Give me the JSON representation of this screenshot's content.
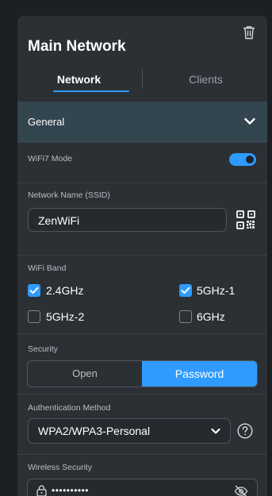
{
  "header": {
    "title": "Main Network",
    "tabs": [
      {
        "label": "Network",
        "active": true
      },
      {
        "label": "Clients",
        "active": false
      }
    ]
  },
  "section": {
    "label": "General",
    "expanded": true
  },
  "wifi7": {
    "label": "WiFi7 Mode",
    "enabled": true
  },
  "ssid": {
    "label": "Network Name (SSID)",
    "value": "ZenWiFi"
  },
  "wifi_band": {
    "label": "WiFi Band",
    "options": [
      {
        "label": "2.4GHz",
        "checked": true
      },
      {
        "label": "5GHz-1",
        "checked": true
      },
      {
        "label": "5GHz-2",
        "checked": false
      },
      {
        "label": "6GHz",
        "checked": false
      }
    ]
  },
  "security": {
    "label": "Security",
    "options": [
      "Open",
      "Password"
    ],
    "selected": "Password"
  },
  "auth": {
    "label": "Authentication Method",
    "value": "WPA2/WPA3-Personal"
  },
  "wireless_security": {
    "label": "Wireless Security",
    "masked_value": "••••••••••"
  },
  "colors": {
    "accent": "#2f9bff",
    "panel": "#2b3034",
    "section_header": "#33454f"
  }
}
